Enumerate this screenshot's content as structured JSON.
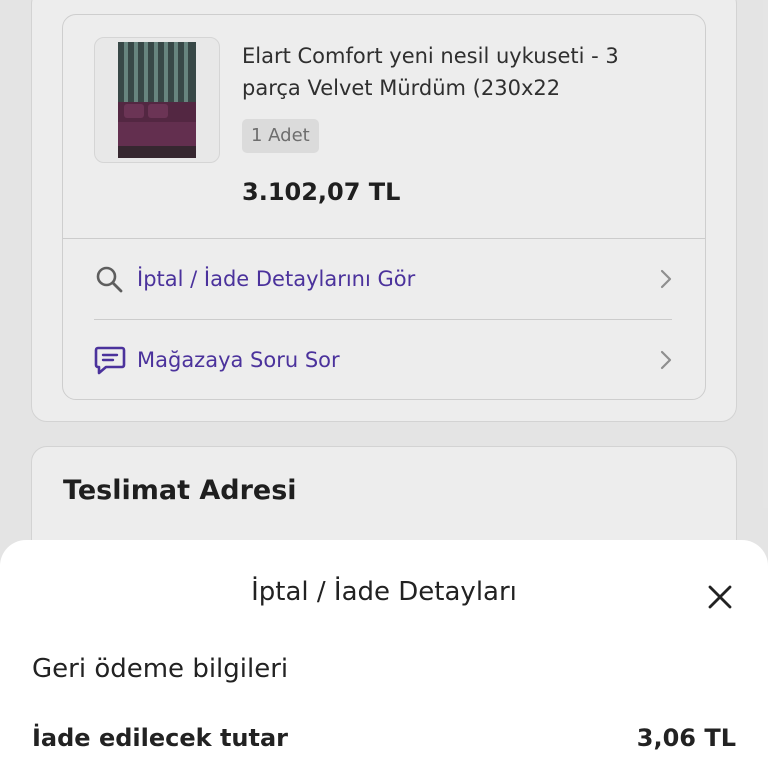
{
  "order": {
    "product": {
      "title": "Elart Comfort yeni nesil uykuseti - 3 parça Velvet Mürdüm (230x22",
      "quantity": "1 Adet",
      "price": "3.102,07 TL",
      "image_icon": "duvet-set-thumbnail"
    },
    "actions": [
      {
        "label": "İptal / İade Detaylarını Gör",
        "icon": "search-icon"
      },
      {
        "label": "Mağazaya Soru Sor",
        "icon": "message-icon"
      }
    ]
  },
  "address": {
    "title": "Teslimat Adresi"
  },
  "sheet": {
    "title": "İptal / İade Detayları",
    "section_title": "Geri ödeme bilgileri",
    "refund_label": "İade edilecek tutar",
    "refund_value": "3,06 TL"
  },
  "colors": {
    "accent": "#5136a8",
    "text": "#222222",
    "muted_text": "#777777",
    "chevron": "#9a9a9a",
    "page_background": "#f6f6f6"
  }
}
